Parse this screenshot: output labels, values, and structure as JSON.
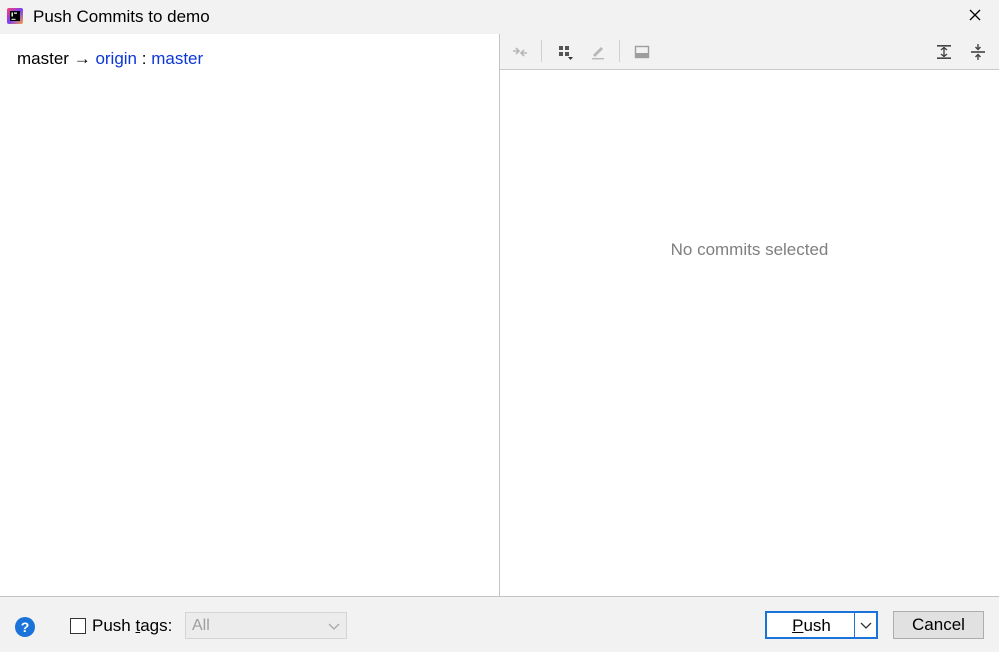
{
  "window": {
    "title": "Push Commits to demo",
    "app_icon": "intellij-idea-icon",
    "close_icon": "close-icon"
  },
  "push_spec": {
    "local_branch": "master",
    "arrow": "→",
    "remote": "origin",
    "separator": " : ",
    "remote_branch": "master"
  },
  "toolbar": {
    "icons": [
      "collapse-compare-icon",
      "group-by-icon",
      "edit-icon",
      "preview-panel-icon",
      "expand-all-icon",
      "collapse-all-icon"
    ]
  },
  "details": {
    "empty_text": "No commits selected"
  },
  "footer": {
    "help_label": "?",
    "push_tags_label_prefix": "Push ",
    "push_tags_label_mnemonic": "t",
    "push_tags_label_suffix": "ags:",
    "push_tags_checked": false,
    "tags_combo_value": "All",
    "push_button_mnemonic": "P",
    "push_button_rest": "ush",
    "cancel_button": "Cancel"
  },
  "colors": {
    "accent": "#1a73d9",
    "link": "#0b37d6",
    "muted_text": "#7f7f7f",
    "background": "#f2f2f2"
  }
}
